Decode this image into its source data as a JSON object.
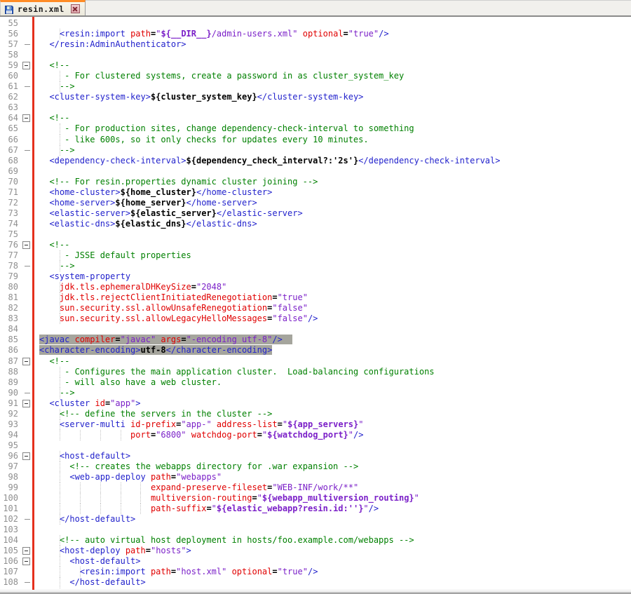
{
  "tab": {
    "title": "resin.xml",
    "state_icon": "saved-floppy-icon",
    "close_icon": "close-x-icon"
  },
  "colors": {
    "tag": "#2222cc",
    "attribute": "#e00000",
    "value": "#7b20c8",
    "text_content": "#000000",
    "comment": "#008000",
    "selection_background": "#a5a59d",
    "change_bar": "#e5301d",
    "tab_accent": "#ff8c26",
    "line_number": "#8f8f8f"
  },
  "editor": {
    "first_line": 55,
    "last_line": 108,
    "lines": [
      {
        "n": 55,
        "f": "",
        "s": false,
        "k": []
      },
      {
        "n": 56,
        "f": "",
        "s": false,
        "k": [
          [
            "w",
            "    "
          ],
          [
            "t",
            "<resin:import "
          ],
          [
            "a",
            "path"
          ],
          [
            "e",
            "="
          ],
          [
            "v",
            "\""
          ],
          [
            "x",
            "${__DIR__}"
          ],
          [
            "v",
            "/admin-users.xml\""
          ],
          [
            "w",
            " "
          ],
          [
            "a",
            "optional"
          ],
          [
            "e",
            "="
          ],
          [
            "v",
            "\"true\""
          ],
          [
            "t",
            "/>"
          ]
        ]
      },
      {
        "n": 57,
        "f": "t",
        "s": false,
        "k": [
          [
            "w",
            "  "
          ],
          [
            "t",
            "</resin:AdminAuthenticator>"
          ]
        ]
      },
      {
        "n": 58,
        "f": "",
        "s": false,
        "k": []
      },
      {
        "n": 59,
        "f": "b",
        "s": false,
        "k": [
          [
            "w",
            "  "
          ],
          [
            "c",
            "<!--"
          ]
        ]
      },
      {
        "n": 60,
        "f": "",
        "s": false,
        "k": [
          [
            "w",
            "     "
          ],
          [
            "c",
            "- For clustered systems, create a password in as cluster_system_key"
          ]
        ]
      },
      {
        "n": 61,
        "f": "t",
        "s": false,
        "k": [
          [
            "w",
            "    "
          ],
          [
            "c",
            "-->"
          ]
        ]
      },
      {
        "n": 62,
        "f": "",
        "s": false,
        "k": [
          [
            "w",
            "  "
          ],
          [
            "t",
            "<cluster-system-key>"
          ],
          [
            "b",
            "${cluster_system_key}"
          ],
          [
            "t",
            "</cluster-system-key>"
          ]
        ]
      },
      {
        "n": 63,
        "f": "",
        "s": false,
        "k": []
      },
      {
        "n": 64,
        "f": "b",
        "s": false,
        "k": [
          [
            "w",
            "  "
          ],
          [
            "c",
            "<!--"
          ]
        ]
      },
      {
        "n": 65,
        "f": "",
        "s": false,
        "k": [
          [
            "w",
            "     "
          ],
          [
            "c",
            "- For production sites, change dependency-check-interval to something"
          ]
        ]
      },
      {
        "n": 66,
        "f": "",
        "s": false,
        "k": [
          [
            "w",
            "     "
          ],
          [
            "c",
            "- like 600s, so it only checks for updates every 10 minutes."
          ]
        ]
      },
      {
        "n": 67,
        "f": "t",
        "s": false,
        "k": [
          [
            "w",
            "    "
          ],
          [
            "c",
            "-->"
          ]
        ]
      },
      {
        "n": 68,
        "f": "",
        "s": false,
        "k": [
          [
            "w",
            "  "
          ],
          [
            "t",
            "<dependency-check-interval>"
          ],
          [
            "b",
            "${dependency_check_interval?:'2s'}"
          ],
          [
            "t",
            "</dependency-check-interval>"
          ]
        ]
      },
      {
        "n": 69,
        "f": "",
        "s": false,
        "k": []
      },
      {
        "n": 70,
        "f": "",
        "s": false,
        "k": [
          [
            "w",
            "  "
          ],
          [
            "c",
            "<!-- For resin.properties dynamic cluster joining -->"
          ]
        ]
      },
      {
        "n": 71,
        "f": "",
        "s": false,
        "k": [
          [
            "w",
            "  "
          ],
          [
            "t",
            "<home-cluster>"
          ],
          [
            "b",
            "${home_cluster}"
          ],
          [
            "t",
            "</home-cluster>"
          ]
        ]
      },
      {
        "n": 72,
        "f": "",
        "s": false,
        "k": [
          [
            "w",
            "  "
          ],
          [
            "t",
            "<home-server>"
          ],
          [
            "b",
            "${home_server}"
          ],
          [
            "t",
            "</home-server>"
          ]
        ]
      },
      {
        "n": 73,
        "f": "",
        "s": false,
        "k": [
          [
            "w",
            "  "
          ],
          [
            "t",
            "<elastic-server>"
          ],
          [
            "b",
            "${elastic_server}"
          ],
          [
            "t",
            "</elastic-server>"
          ]
        ]
      },
      {
        "n": 74,
        "f": "",
        "s": false,
        "k": [
          [
            "w",
            "  "
          ],
          [
            "t",
            "<elastic-dns>"
          ],
          [
            "b",
            "${elastic_dns}"
          ],
          [
            "t",
            "</elastic-dns>"
          ]
        ]
      },
      {
        "n": 75,
        "f": "",
        "s": false,
        "k": []
      },
      {
        "n": 76,
        "f": "b",
        "s": false,
        "k": [
          [
            "w",
            "  "
          ],
          [
            "c",
            "<!--"
          ]
        ]
      },
      {
        "n": 77,
        "f": "",
        "s": false,
        "k": [
          [
            "w",
            "     "
          ],
          [
            "c",
            "- JSSE default properties"
          ]
        ]
      },
      {
        "n": 78,
        "f": "t",
        "s": false,
        "k": [
          [
            "w",
            "    "
          ],
          [
            "c",
            "-->"
          ]
        ]
      },
      {
        "n": 79,
        "f": "",
        "s": false,
        "k": [
          [
            "w",
            "  "
          ],
          [
            "t",
            "<system-property"
          ]
        ]
      },
      {
        "n": 80,
        "f": "",
        "s": false,
        "k": [
          [
            "w",
            "    "
          ],
          [
            "a",
            "jdk.tls.ephemeralDHKeySize"
          ],
          [
            "e",
            "="
          ],
          [
            "v",
            "\"2048\""
          ]
        ]
      },
      {
        "n": 81,
        "f": "",
        "s": false,
        "k": [
          [
            "w",
            "    "
          ],
          [
            "a",
            "jdk.tls.rejectClientInitiatedRenegotiation"
          ],
          [
            "e",
            "="
          ],
          [
            "v",
            "\"true\""
          ]
        ]
      },
      {
        "n": 82,
        "f": "",
        "s": false,
        "k": [
          [
            "w",
            "    "
          ],
          [
            "a",
            "sun.security.ssl.allowUnsafeRenegotiation"
          ],
          [
            "e",
            "="
          ],
          [
            "v",
            "\"false\""
          ]
        ]
      },
      {
        "n": 83,
        "f": "",
        "s": false,
        "k": [
          [
            "w",
            "    "
          ],
          [
            "a",
            "sun.security.ssl.allowLegacyHelloMessages"
          ],
          [
            "e",
            "="
          ],
          [
            "v",
            "\"false\""
          ],
          [
            "t",
            "/>"
          ]
        ]
      },
      {
        "n": 84,
        "f": "",
        "s": false,
        "k": []
      },
      {
        "n": 85,
        "f": "",
        "s": true,
        "ext": true,
        "k": [
          [
            "t",
            "<javac "
          ],
          [
            "a",
            "compiler"
          ],
          [
            "e",
            "="
          ],
          [
            "v",
            "\"javac\""
          ],
          [
            "w",
            " "
          ],
          [
            "a",
            "args"
          ],
          [
            "e",
            "="
          ],
          [
            "v",
            "\"-encoding utf-8\""
          ],
          [
            "t",
            "/>"
          ]
        ]
      },
      {
        "n": 86,
        "f": "",
        "s": true,
        "ext": false,
        "k": [
          [
            "t",
            "<character-encoding>"
          ],
          [
            "b",
            "utf-8"
          ],
          [
            "t",
            "</character-encoding>"
          ]
        ]
      },
      {
        "n": 87,
        "f": "b",
        "s": false,
        "k": [
          [
            "w",
            "  "
          ],
          [
            "c",
            "<!--"
          ]
        ]
      },
      {
        "n": 88,
        "f": "",
        "s": false,
        "k": [
          [
            "w",
            "     "
          ],
          [
            "c",
            "- Configures the main application cluster.  Load-balancing configurations"
          ]
        ]
      },
      {
        "n": 89,
        "f": "",
        "s": false,
        "k": [
          [
            "w",
            "     "
          ],
          [
            "c",
            "- will also have a web cluster."
          ]
        ]
      },
      {
        "n": 90,
        "f": "t",
        "s": false,
        "k": [
          [
            "w",
            "    "
          ],
          [
            "c",
            "-->"
          ]
        ]
      },
      {
        "n": 91,
        "f": "b",
        "s": false,
        "k": [
          [
            "w",
            "  "
          ],
          [
            "t",
            "<cluster "
          ],
          [
            "a",
            "id"
          ],
          [
            "e",
            "="
          ],
          [
            "v",
            "\"app\""
          ],
          [
            "t",
            ">"
          ]
        ]
      },
      {
        "n": 92,
        "f": "",
        "s": false,
        "k": [
          [
            "w",
            "    "
          ],
          [
            "c",
            "<!-- define the servers in the cluster -->"
          ]
        ]
      },
      {
        "n": 93,
        "f": "",
        "s": false,
        "k": [
          [
            "w",
            "    "
          ],
          [
            "t",
            "<server-multi "
          ],
          [
            "a",
            "id-prefix"
          ],
          [
            "e",
            "="
          ],
          [
            "v",
            "\"app-\""
          ],
          [
            "w",
            " "
          ],
          [
            "a",
            "address-list"
          ],
          [
            "e",
            "="
          ],
          [
            "v",
            "\""
          ],
          [
            "x",
            "${app_servers}"
          ],
          [
            "v",
            "\""
          ]
        ]
      },
      {
        "n": 94,
        "f": "",
        "s": false,
        "k": [
          [
            "w",
            "                  "
          ],
          [
            "a",
            "port"
          ],
          [
            "e",
            "="
          ],
          [
            "v",
            "\"6800\""
          ],
          [
            "w",
            " "
          ],
          [
            "a",
            "watchdog-port"
          ],
          [
            "e",
            "="
          ],
          [
            "v",
            "\""
          ],
          [
            "x",
            "${watchdog_port}"
          ],
          [
            "v",
            "\""
          ],
          [
            "t",
            "/>"
          ]
        ]
      },
      {
        "n": 95,
        "f": "",
        "s": false,
        "k": []
      },
      {
        "n": 96,
        "f": "b",
        "s": false,
        "k": [
          [
            "w",
            "    "
          ],
          [
            "t",
            "<host-default>"
          ]
        ]
      },
      {
        "n": 97,
        "f": "",
        "s": false,
        "k": [
          [
            "w",
            "      "
          ],
          [
            "c",
            "<!-- creates the webapps directory for .war expansion -->"
          ]
        ]
      },
      {
        "n": 98,
        "f": "",
        "s": false,
        "k": [
          [
            "w",
            "      "
          ],
          [
            "t",
            "<web-app-deploy "
          ],
          [
            "a",
            "path"
          ],
          [
            "e",
            "="
          ],
          [
            "v",
            "\"webapps\""
          ]
        ]
      },
      {
        "n": 99,
        "f": "",
        "s": false,
        "k": [
          [
            "w",
            "                      "
          ],
          [
            "a",
            "expand-preserve-fileset"
          ],
          [
            "e",
            "="
          ],
          [
            "v",
            "\"WEB-INF/work/**\""
          ]
        ]
      },
      {
        "n": 100,
        "f": "",
        "s": false,
        "k": [
          [
            "w",
            "                      "
          ],
          [
            "a",
            "multiversion-routing"
          ],
          [
            "e",
            "="
          ],
          [
            "v",
            "\""
          ],
          [
            "x",
            "${webapp_multiversion_routing}"
          ],
          [
            "v",
            "\""
          ]
        ]
      },
      {
        "n": 101,
        "f": "",
        "s": false,
        "k": [
          [
            "w",
            "                      "
          ],
          [
            "a",
            "path-suffix"
          ],
          [
            "e",
            "="
          ],
          [
            "v",
            "\""
          ],
          [
            "x",
            "${elastic_webapp?resin.id:''}"
          ],
          [
            "v",
            "\""
          ],
          [
            "t",
            "/>"
          ]
        ]
      },
      {
        "n": 102,
        "f": "t",
        "s": false,
        "k": [
          [
            "w",
            "    "
          ],
          [
            "t",
            "</host-default>"
          ]
        ]
      },
      {
        "n": 103,
        "f": "",
        "s": false,
        "k": []
      },
      {
        "n": 104,
        "f": "",
        "s": false,
        "k": [
          [
            "w",
            "    "
          ],
          [
            "c",
            "<!-- auto virtual host deployment in hosts/foo.example.com/webapps -->"
          ]
        ]
      },
      {
        "n": 105,
        "f": "b",
        "s": false,
        "k": [
          [
            "w",
            "    "
          ],
          [
            "t",
            "<host-deploy "
          ],
          [
            "a",
            "path"
          ],
          [
            "e",
            "="
          ],
          [
            "v",
            "\"hosts\""
          ],
          [
            "t",
            ">"
          ]
        ]
      },
      {
        "n": 106,
        "f": "b",
        "s": false,
        "k": [
          [
            "w",
            "      "
          ],
          [
            "t",
            "<host-default>"
          ]
        ]
      },
      {
        "n": 107,
        "f": "",
        "s": false,
        "k": [
          [
            "w",
            "        "
          ],
          [
            "t",
            "<resin:import "
          ],
          [
            "a",
            "path"
          ],
          [
            "e",
            "="
          ],
          [
            "v",
            "\"host.xml\""
          ],
          [
            "w",
            " "
          ],
          [
            "a",
            "optional"
          ],
          [
            "e",
            "="
          ],
          [
            "v",
            "\"true\""
          ],
          [
            "t",
            "/>"
          ]
        ]
      },
      {
        "n": 108,
        "f": "t",
        "s": false,
        "k": [
          [
            "w",
            "      "
          ],
          [
            "t",
            "</host-default>"
          ]
        ]
      }
    ]
  }
}
